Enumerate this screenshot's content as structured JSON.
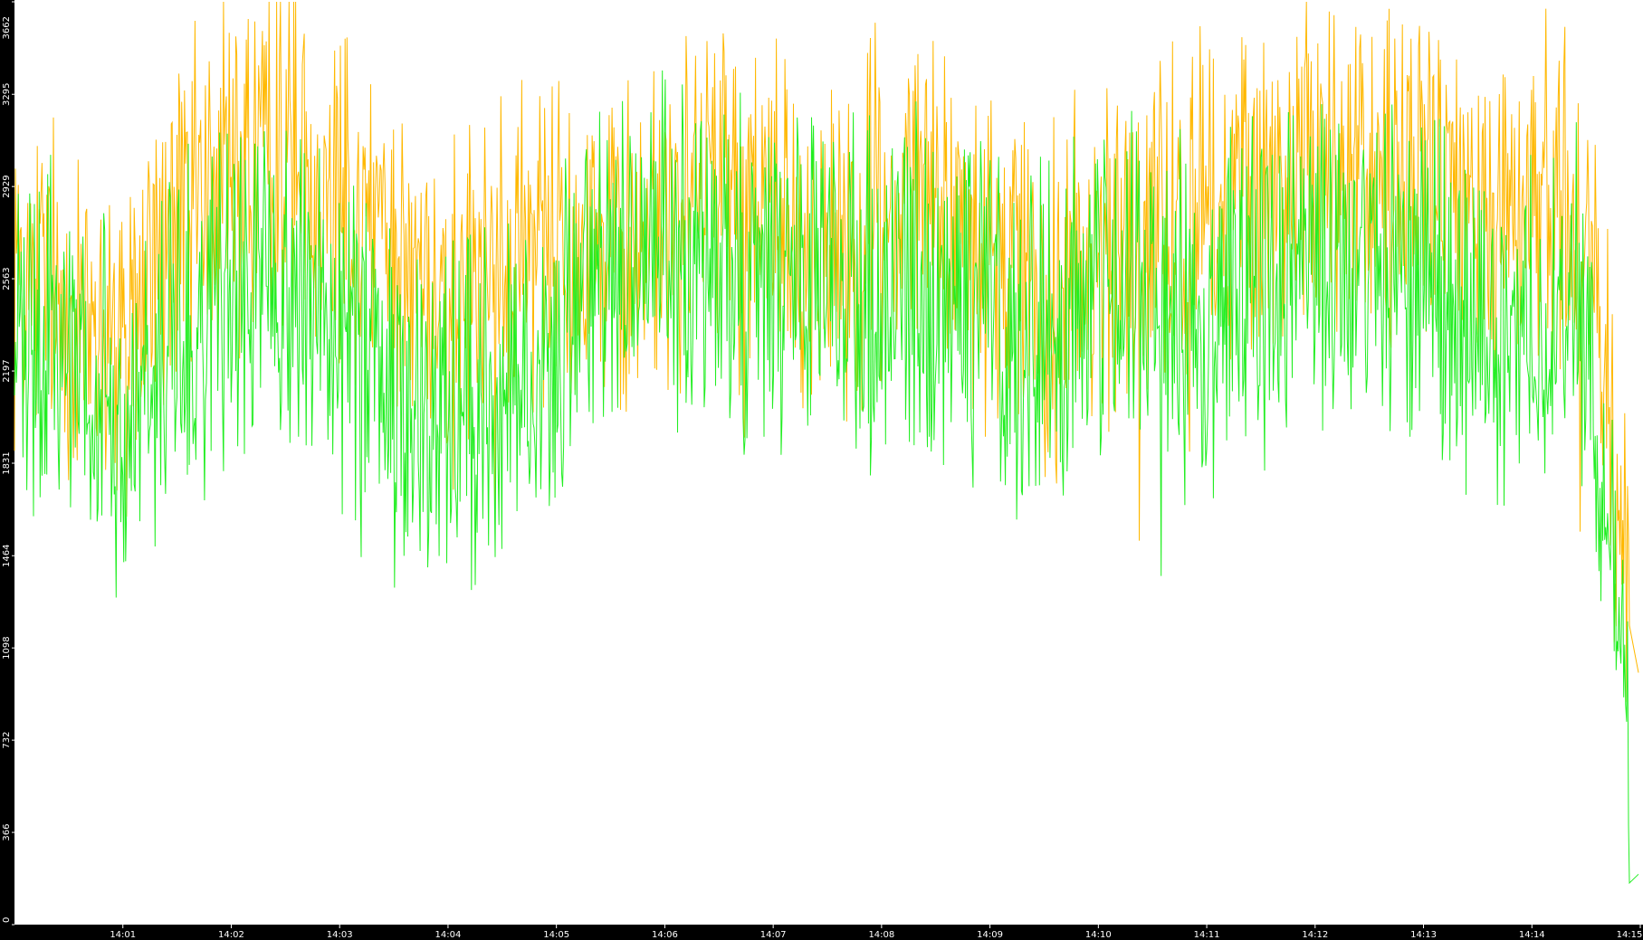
{
  "chart_data": {
    "type": "line",
    "title": "",
    "xlabel": "",
    "ylabel": "",
    "grid": false,
    "legend": "none",
    "y_ticks": [
      "0",
      "366",
      "732",
      "1098",
      "1464",
      "1831",
      "2197",
      "2563",
      "2929",
      "3295",
      "3662"
    ],
    "y_tick_values": [
      0,
      366,
      732,
      1098,
      1464,
      1831,
      2197,
      2563,
      2929,
      3295,
      3662
    ],
    "x_ticks": [
      "14:01",
      "14:02",
      "14:03",
      "14:04",
      "14:05",
      "14:06",
      "14:07",
      "14:08",
      "14:09",
      "14:10",
      "14:11",
      "14:12",
      "14:13",
      "14:14",
      "14:15"
    ],
    "x_range": [
      "14:00",
      "14:15"
    ],
    "ylim": [
      0,
      3662
    ],
    "series": [
      {
        "color": "#ffb800",
        "x": [
          "14:00",
          "14:00:30",
          "14:01",
          "14:01:30",
          "14:02",
          "14:02:30",
          "14:03",
          "14:03:30",
          "14:04",
          "14:04:30",
          "14:05",
          "14:05:30",
          "14:06",
          "14:06:30",
          "14:07",
          "14:07:30",
          "14:08",
          "14:08:30",
          "14:09",
          "14:09:30",
          "14:10",
          "14:10:30",
          "14:11",
          "14:11:30",
          "14:12",
          "14:12:30",
          "14:13",
          "14:13:30",
          "14:14",
          "14:14:30",
          "14:15"
        ],
        "values": [
          2650,
          2450,
          2250,
          2800,
          3050,
          3100,
          2950,
          2700,
          2450,
          2550,
          2850,
          2650,
          2750,
          2950,
          2800,
          2700,
          2900,
          2850,
          2650,
          2500,
          2650,
          2750,
          2850,
          2900,
          3000,
          2950,
          3000,
          2850,
          2950,
          2750,
          1000
        ]
      },
      {
        "color": "#22ee22",
        "x": [
          "14:00",
          "14:00:30",
          "14:01",
          "14:01:30",
          "14:02",
          "14:02:30",
          "14:03",
          "14:03:30",
          "14:04",
          "14:04:30",
          "14:05",
          "14:05:30",
          "14:06",
          "14:06:30",
          "14:07",
          "14:07:30",
          "14:08",
          "14:08:30",
          "14:09",
          "14:09:30",
          "14:10",
          "14:10:30",
          "14:11",
          "14:11:30",
          "14:12",
          "14:12:30",
          "14:13",
          "14:13:30",
          "14:14",
          "14:14:30",
          "14:15"
        ],
        "values": [
          2300,
          2250,
          2050,
          2350,
          2500,
          2550,
          2350,
          2050,
          1950,
          2050,
          2300,
          2600,
          2700,
          2600,
          2550,
          2450,
          2500,
          2550,
          2450,
          2300,
          2550,
          2500,
          2400,
          2500,
          2650,
          2600,
          2550,
          2400,
          2350,
          2450,
          200
        ]
      }
    ]
  }
}
